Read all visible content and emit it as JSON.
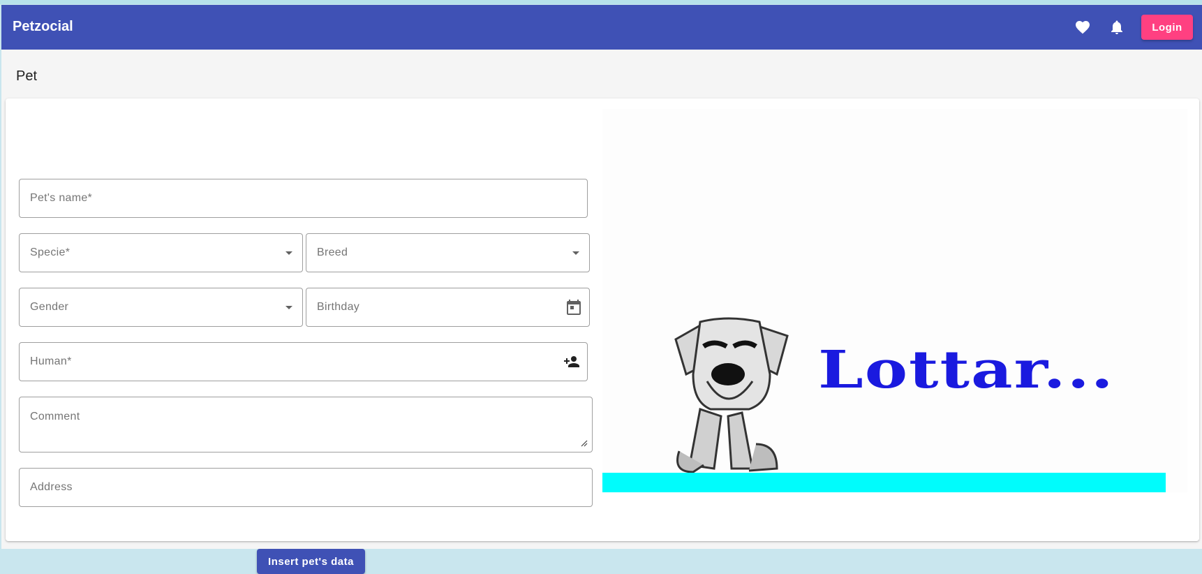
{
  "app": {
    "title": "Petzocial"
  },
  "toolbar": {
    "favorites_icon": "heart-icon",
    "notifications_icon": "bell-icon",
    "login_label": "Login",
    "login_color": "#ff4081",
    "bar_color": "#3f51b5"
  },
  "page": {
    "title": "Pet"
  },
  "form": {
    "pet_name": {
      "placeholder": "Pet's name*",
      "value": ""
    },
    "specie": {
      "placeholder": "Specie*",
      "value": ""
    },
    "breed": {
      "placeholder": "Breed",
      "value": ""
    },
    "gender": {
      "placeholder": "Gender",
      "value": ""
    },
    "birthday": {
      "placeholder": "Birthday",
      "value": "",
      "icon": "calendar-icon"
    },
    "human": {
      "placeholder": "Human*",
      "value": "",
      "icon": "person-add-icon"
    },
    "comment": {
      "placeholder": "Comment",
      "value": ""
    },
    "address": {
      "placeholder": "Address",
      "value": ""
    },
    "submit_label": "Insert pet's data"
  },
  "image": {
    "logo_text": "Lottar..."
  }
}
